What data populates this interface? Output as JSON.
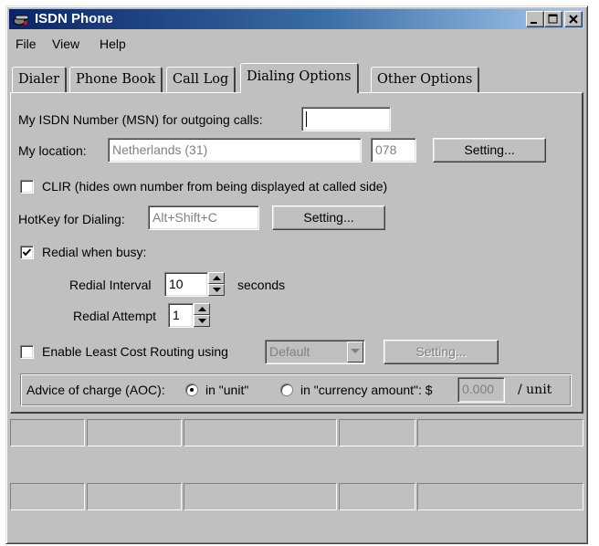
{
  "window": {
    "title": "ISDN Phone"
  },
  "menu": [
    "File",
    "View",
    "Help"
  ],
  "tabs": [
    "Dialer",
    "Phone Book",
    "Call Log",
    "Dialing Options",
    "Other Options"
  ],
  "active_tab": "Dialing Options",
  "form": {
    "msn_label": "My ISDN Number (MSN) for outgoing calls:",
    "msn_value": "",
    "location_label": "My location:",
    "location_value": "Netherlands (31)",
    "area_code": "078",
    "location_button": "Setting...",
    "clir_label": "CLIR (hides own number from being displayed at called side)",
    "clir_checked": false,
    "hotkey_label": "HotKey for Dialing:",
    "hotkey_value": "Alt+Shift+C",
    "hotkey_button": "Setting...",
    "redial_label": "Redial when busy:",
    "redial_checked": true,
    "redial_interval_label": "Redial Interval",
    "redial_interval_value": "10",
    "redial_interval_unit": "seconds",
    "redial_attempt_label": "Redial Attempt",
    "redial_attempt_value": "1",
    "lcr_label": "Enable Least Cost Routing using",
    "lcr_checked": false,
    "lcr_select": "Default",
    "lcr_button": "Setting...",
    "aoc_label": "Advice of charge (AOC):",
    "aoc_opt_unit": "in \"unit\"",
    "aoc_opt_currency": "in \"currency amount\": $",
    "aoc_selected": "unit",
    "aoc_amount": "0.000",
    "aoc_per_unit": "/ unit"
  },
  "colors": {
    "face": "#c0c0c0",
    "title_start": "#0a246a",
    "title_end": "#a6caf0",
    "disabled_text": "#808080"
  }
}
